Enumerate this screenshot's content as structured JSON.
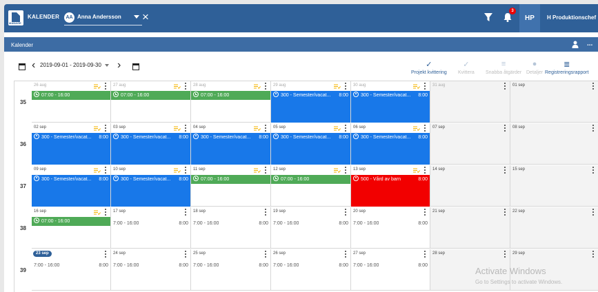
{
  "header": {
    "app_logo_text": "MANAGE",
    "app_title": "KALENDER",
    "user_initials": "AA",
    "user_name": "Anna Andersson",
    "notification_count": "3",
    "profile_initials": "HP",
    "profile_name": "H Produktionschef"
  },
  "panel": {
    "title": "Kalender",
    "more_label": "..."
  },
  "toolbar": {
    "date_range": "2019-09-01 - 2019-09-30",
    "actions": [
      {
        "label": "Projekt kvittering",
        "icon": "check-icon"
      },
      {
        "label": "Kvittera",
        "icon": "check-icon"
      },
      {
        "label": "Snabba åtgärder",
        "icon": "list-add-icon"
      },
      {
        "label": "Detaljer",
        "icon": "info-icon"
      },
      {
        "label": "Registreringsrapport",
        "icon": "report-icon"
      }
    ]
  },
  "weeks": [
    {
      "number": "35",
      "days": [
        {
          "date": "26 aug",
          "event": {
            "color": "green",
            "icon": "clock",
            "text": "07:00 - 16:00"
          }
        },
        {
          "date": "27 aug",
          "event": {
            "color": "green",
            "icon": "clock",
            "text": "07:00 - 16:00"
          }
        },
        {
          "date": "28 aug",
          "event": {
            "color": "green",
            "icon": "clock",
            "text": "07:00 - 16:00"
          }
        },
        {
          "date": "29 aug",
          "event": {
            "color": "blue",
            "icon": "person",
            "text": "300 - Semester/vacat...",
            "hours": "8:00"
          }
        },
        {
          "date": "30 aug",
          "event": {
            "color": "blue",
            "icon": "person",
            "text": "300 - Semester/vacat...",
            "hours": "8:00"
          }
        },
        {
          "date": "31 aug"
        },
        {
          "date": "01 sep"
        }
      ]
    },
    {
      "number": "36",
      "days": [
        {
          "date": "02 sep",
          "event": {
            "color": "blue",
            "icon": "person",
            "text": "300 - Semester/vacat...",
            "hours": "8:00"
          }
        },
        {
          "date": "03 sep",
          "event": {
            "color": "blue",
            "icon": "person",
            "text": "300 - Semester/vacat...",
            "hours": "8:00"
          }
        },
        {
          "date": "04 sep",
          "event": {
            "color": "blue",
            "icon": "person",
            "text": "300 - Semester/vacat...",
            "hours": "8:00"
          }
        },
        {
          "date": "05 sep",
          "event": {
            "color": "blue",
            "icon": "person",
            "text": "300 - Semester/vacat...",
            "hours": "8:00"
          }
        },
        {
          "date": "06 sep",
          "event": {
            "color": "blue",
            "icon": "person",
            "text": "300 - Semester/vacat...",
            "hours": "8:00"
          }
        },
        {
          "date": "07 sep"
        },
        {
          "date": "08 sep"
        }
      ]
    },
    {
      "number": "37",
      "days": [
        {
          "date": "09 sep",
          "event": {
            "color": "blue",
            "icon": "person",
            "text": "300 - Semester/vacat...",
            "hours": "8:00"
          }
        },
        {
          "date": "10 sep",
          "event": {
            "color": "blue",
            "icon": "person",
            "text": "300 - Semester/vacat...",
            "hours": "8:00"
          }
        },
        {
          "date": "11 sep",
          "event": {
            "color": "green",
            "icon": "clock",
            "text": "07:00 - 16:00"
          }
        },
        {
          "date": "12 sep",
          "event": {
            "color": "green",
            "icon": "clock",
            "text": "07:00 - 16:00"
          }
        },
        {
          "date": "13 sep",
          "event": {
            "color": "red",
            "icon": "person",
            "text": "500 - Vård av barn",
            "hours": "8:00"
          }
        },
        {
          "date": "14 sep"
        },
        {
          "date": "15 sep"
        }
      ]
    },
    {
      "number": "38",
      "days": [
        {
          "date": "16 sep",
          "event": {
            "color": "green",
            "icon": "clock",
            "text": "07:00 - 16:00"
          }
        },
        {
          "date": "17 sep",
          "plan": "7:00 - 16:00",
          "hours": "8:00"
        },
        {
          "date": "18 sep",
          "plan": "7:00 - 16:00",
          "hours": "8:00"
        },
        {
          "date": "19 sep",
          "plan": "7:00 - 16:00",
          "hours": "8:00"
        },
        {
          "date": "20 sep",
          "plan": "7:00 - 16:00",
          "hours": "8:00"
        },
        {
          "date": "21 sep"
        },
        {
          "date": "22 sep"
        }
      ]
    },
    {
      "number": "39",
      "days": [
        {
          "date": "23 sep",
          "today": true,
          "plan": "7:00 - 16:00",
          "hours": "8:00"
        },
        {
          "date": "24 sep",
          "plan": "7:00 - 16:00",
          "hours": "8:00"
        },
        {
          "date": "25 sep",
          "plan": "7:00 - 16:00",
          "hours": "8:00"
        },
        {
          "date": "26 sep",
          "plan": "7:00 - 16:00",
          "hours": "8:00"
        },
        {
          "date": "27 sep",
          "plan": "7:00 - 16:00",
          "hours": "8:00"
        },
        {
          "date": "28 sep"
        },
        {
          "date": "29 sep"
        }
      ]
    }
  ],
  "watermark": {
    "line1": "Activate Windows",
    "line2": "Go to Settings to activate Windows."
  },
  "colors": {
    "header": "#2f6098",
    "green": "#4faa57",
    "blue": "#1878e9",
    "red": "#f20000"
  }
}
